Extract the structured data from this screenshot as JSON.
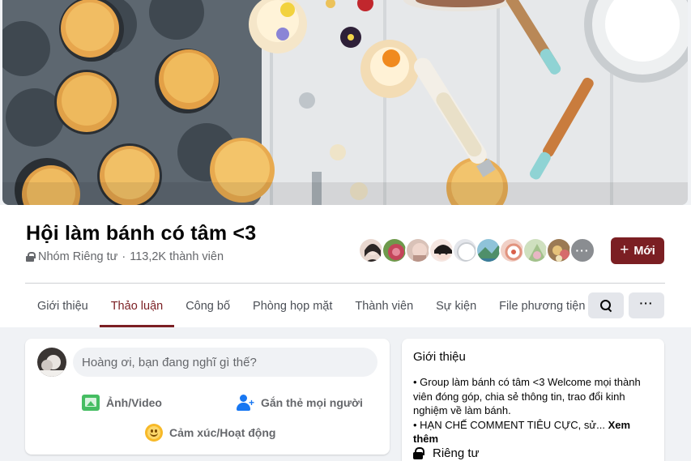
{
  "group": {
    "name": "Hội làm bánh có tâm <3",
    "privacy": "Nhóm Riêng tư",
    "members": "113,2K thành viên",
    "meta_sep": "·",
    "new_button": "Mới",
    "new_button_plus": "+"
  },
  "cover": {
    "image_icon": "cupcake-baking-cover-photo"
  },
  "member_avatars": [
    {
      "icon": "member-avatar-1",
      "color": "#e9d7cf"
    },
    {
      "icon": "member-avatar-2",
      "color": "#b84a5c"
    },
    {
      "icon": "member-avatar-3",
      "color": "#c9a59a"
    },
    {
      "icon": "member-avatar-4",
      "color": "#f1ddd6"
    },
    {
      "icon": "member-avatar-5",
      "color": "#e4e6eb"
    },
    {
      "icon": "member-avatar-6",
      "color": "#6aa8a3"
    },
    {
      "icon": "member-avatar-7",
      "color": "#e8b4a8"
    },
    {
      "icon": "member-avatar-8",
      "color": "#b7cfa5"
    },
    {
      "icon": "member-avatar-9",
      "color": "#a98b63"
    }
  ],
  "more_members": "···",
  "tabs": [
    {
      "label": "Giới thiệu"
    },
    {
      "label": "Thảo luận",
      "active": true
    },
    {
      "label": "Công bố"
    },
    {
      "label": "Phòng họp mặt"
    },
    {
      "label": "Thành viên"
    },
    {
      "label": "Sự kiện"
    },
    {
      "label": "File phương tiện"
    }
  ],
  "toolbar": {
    "more": "···"
  },
  "composer": {
    "placeholder": "Hoàng ơi, bạn đang nghĩ gì thế?",
    "photo_video": "Ảnh/Video",
    "tag_people": "Gắn thẻ mọi người",
    "feeling": "Cảm xúc/Hoạt động"
  },
  "about": {
    "title": "Giới thiệu",
    "line1": "• Group làm bánh có tâm <3 Welcome mọi thành viên đóng góp, chia sẻ thông tin, trao đổi kinh nghiệm về làm bánh.",
    "line2": "• HẠN CHẾ COMMENT TIÊU CỰC, sử...",
    "see_more": "Xem thêm",
    "privacy": "Riêng tư"
  },
  "colors": {
    "accent": "#7b1f23",
    "bg": "#f0f2f5"
  }
}
